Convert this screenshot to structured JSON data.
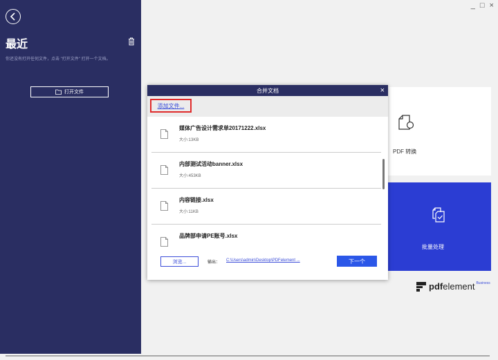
{
  "sidebar": {
    "title": "最近",
    "hint": "你还没有打开任何文件，点击 \"打开文件\" 打开一个文档。",
    "open_button": "打开文件"
  },
  "window_controls": "_ □ ×",
  "cards": {
    "convert_label": "PDF 转换",
    "batch_label": "批量处理"
  },
  "brand": {
    "bold": "pdf",
    "rest": "element",
    "sup": "Business"
  },
  "dialog": {
    "title": "合并文档",
    "close": "×",
    "add_files": "添加文件...",
    "files": [
      {
        "name": "媒体广告设计需求单20171222.xlsx",
        "size": "大小:13KB"
      },
      {
        "name": "内部测试活动banner.xlsx",
        "size": "大小:453KB"
      },
      {
        "name": "内容链接.xlsx",
        "size": "大小:11KB"
      },
      {
        "name": "品牌部申请PE账号.xlsx",
        "size": ""
      }
    ],
    "browse": "浏览...",
    "output_label": "输出：",
    "output_path": "C:\\Users\\admin\\Desktop\\PDFelement ...",
    "next": "下一个"
  }
}
